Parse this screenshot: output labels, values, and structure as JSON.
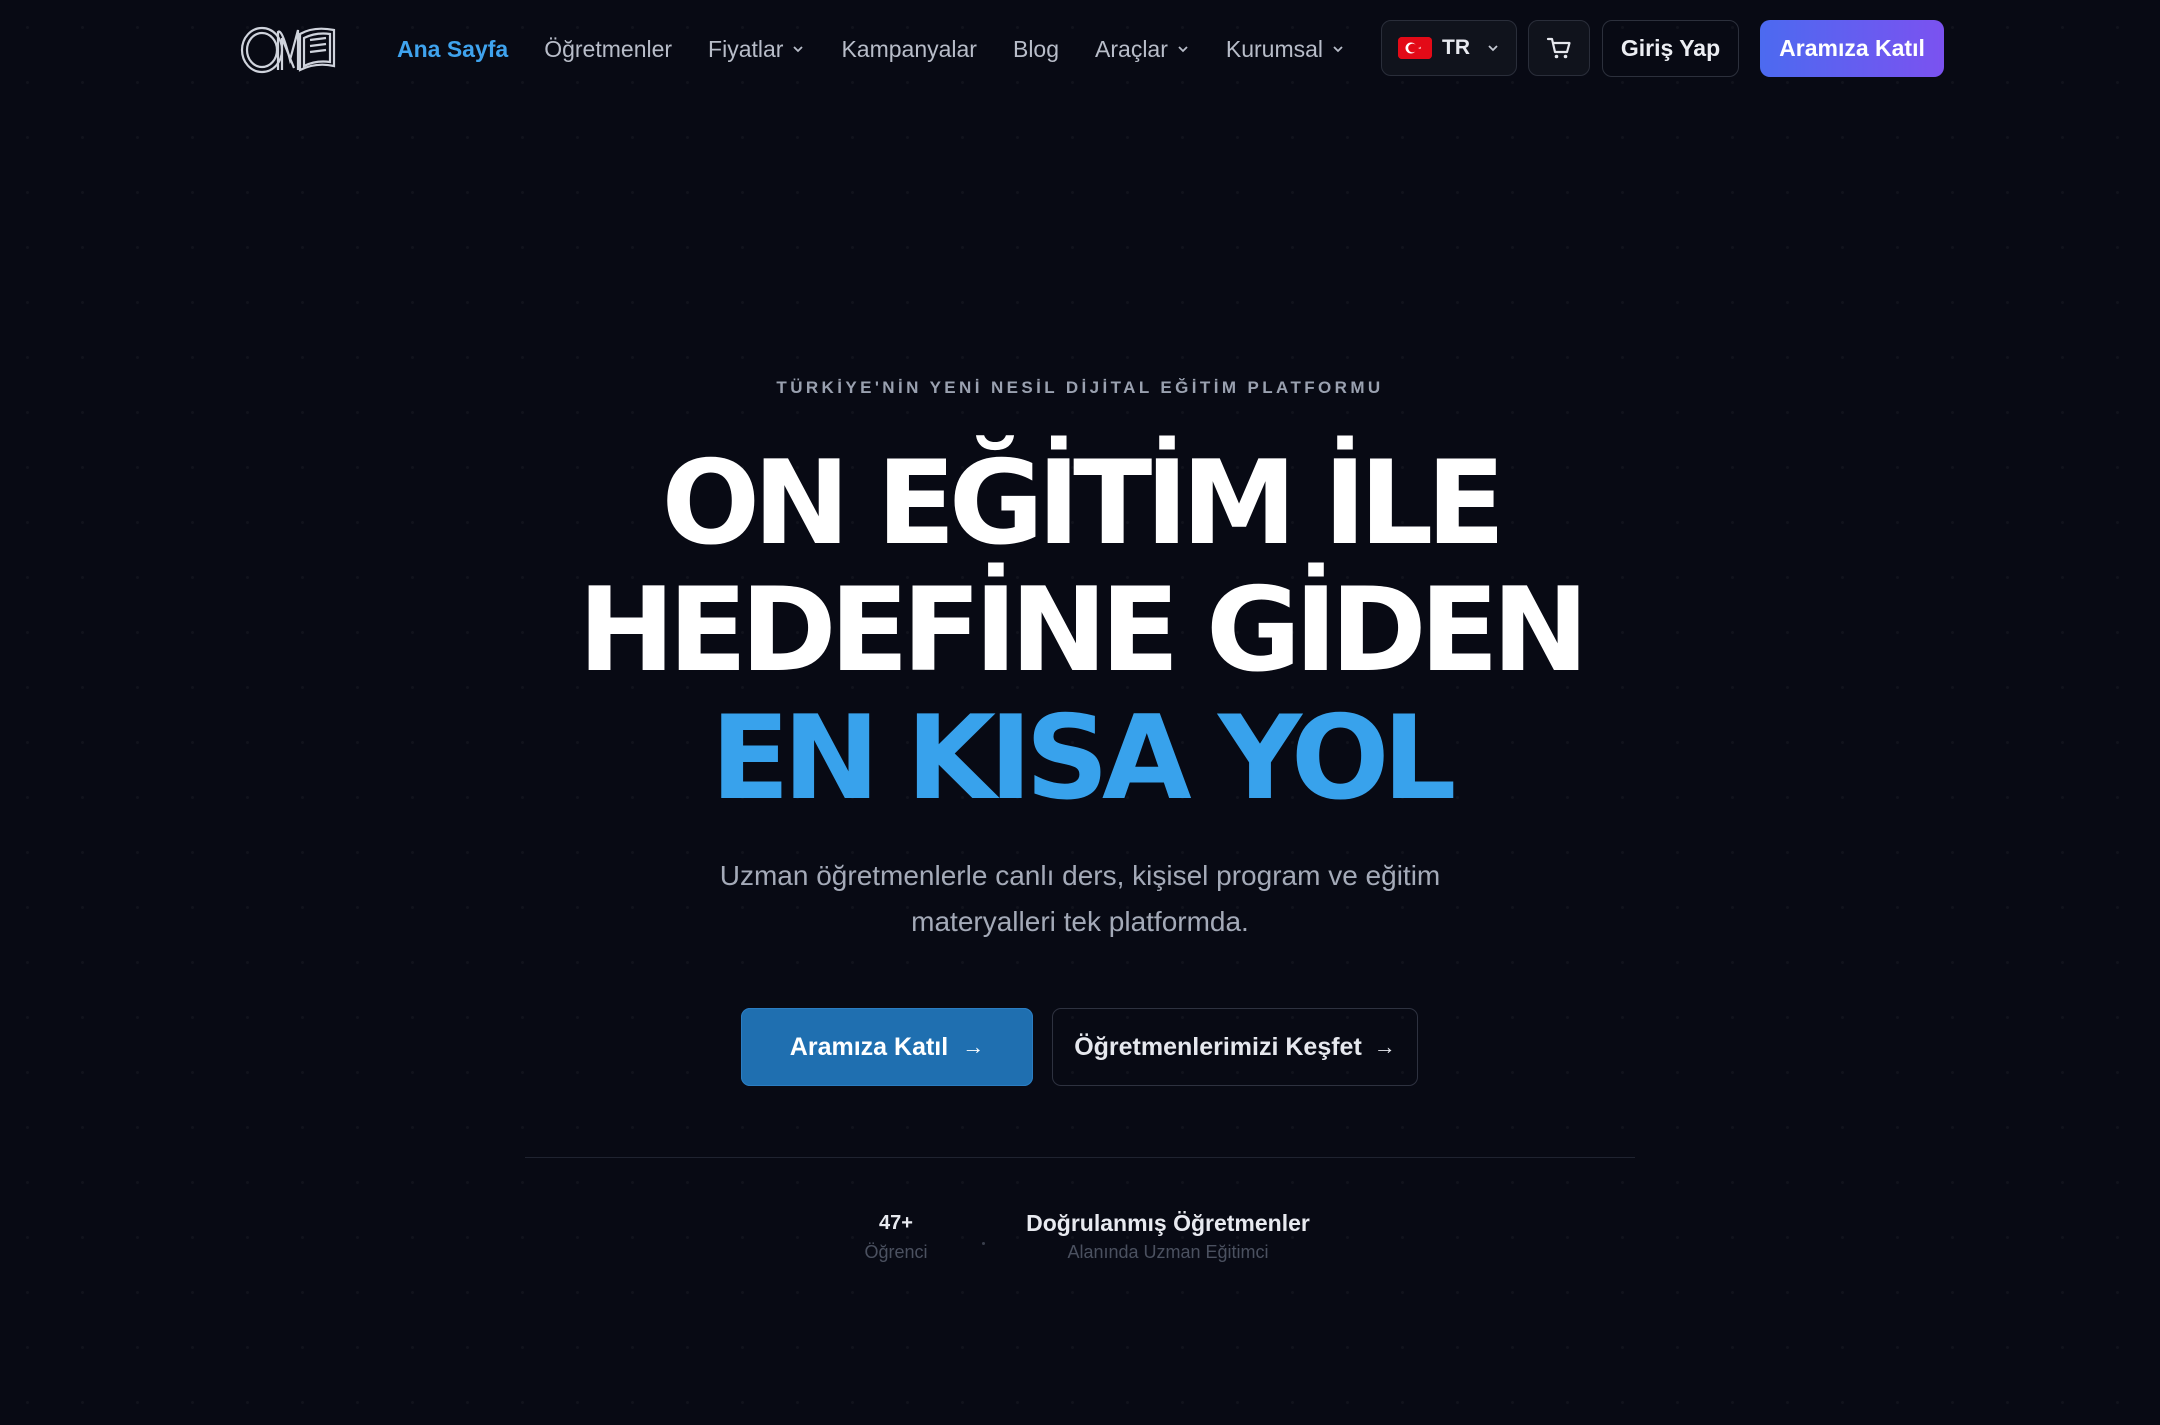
{
  "brand": {
    "logo_text": "ON",
    "logo_icon": "book-logo-icon"
  },
  "nav": {
    "items": [
      {
        "label": "Ana Sayfa",
        "active": true,
        "dropdown": false
      },
      {
        "label": "Öğretmenler",
        "active": false,
        "dropdown": false
      },
      {
        "label": "Fiyatlar",
        "active": false,
        "dropdown": true
      },
      {
        "label": "Kampanyalar",
        "active": false,
        "dropdown": false
      },
      {
        "label": "Blog",
        "active": false,
        "dropdown": false
      },
      {
        "label": "Araçlar",
        "active": false,
        "dropdown": true
      },
      {
        "label": "Kurumsal",
        "active": false,
        "dropdown": true
      }
    ],
    "language": "TR",
    "language_flag": "turkey-flag-icon",
    "cart_icon": "cart-icon",
    "login_label": "Giriş Yap",
    "join_label": "Aramıza Katıl"
  },
  "hero": {
    "eyebrow": "TÜRKİYE'NİN YENİ NESİL DİJİTAL EĞİTİM PLATFORMU",
    "headline_line1": "ON EĞİTİM İLE",
    "headline_line2": "HEDEFİNE GİDEN",
    "headline_line3": "EN KISA YOL",
    "subtitle": "Uzman öğretmenlerle canlı ders, kişisel program ve eğitim materyalleri tek platformda.",
    "cta_primary": "Aramıza Katıl",
    "cta_secondary": "Öğretmenlerimizi Keşfet",
    "cta_arrow": "→"
  },
  "stats": [
    {
      "value": "47+",
      "label": "Öğrenci"
    },
    {
      "value": "Doğrulanmış Öğretmenler",
      "label": "Alanında Uzman Eğitimci"
    }
  ],
  "colors": {
    "background": "#080a14",
    "accent_blue": "#38a2ec",
    "active_nav": "#3fa3ee",
    "cta_primary": "#1f6fb0",
    "join_gradient_start": "#4c6af0",
    "join_gradient_end": "#7b52f0"
  }
}
